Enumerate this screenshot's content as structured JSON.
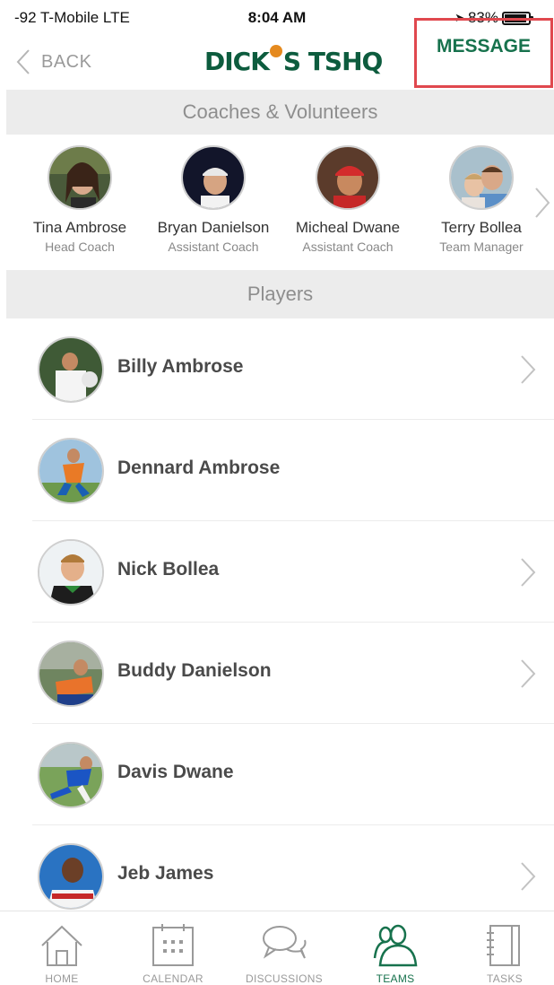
{
  "status_bar": {
    "carrier": "-92 T-Mobile  LTE",
    "time": "8:04 AM",
    "battery": "83%"
  },
  "nav": {
    "back_label": "BACK",
    "logo_text_left": "DICK",
    "logo_text_right": "S TSHQ",
    "message_label": "MESSAGE",
    "accent_color": "#17724d",
    "highlight_color": "#e0484e"
  },
  "coaches_section": {
    "title": "Coaches & Volunteers",
    "items": [
      {
        "name": "Tina Ambrose",
        "role": "Head Coach"
      },
      {
        "name": "Bryan Danielson",
        "role": "Assistant Coach"
      },
      {
        "name": "Micheal Dwane",
        "role": "Assistant Coach"
      },
      {
        "name": "Terry Bollea",
        "role": "Team Manager"
      }
    ]
  },
  "players_section": {
    "title": "Players",
    "items": [
      {
        "name": "Billy Ambrose",
        "has_chevron": true
      },
      {
        "name": "Dennard Ambrose",
        "has_chevron": false
      },
      {
        "name": "Nick Bollea",
        "has_chevron": true
      },
      {
        "name": "Buddy Danielson",
        "has_chevron": true
      },
      {
        "name": "Davis Dwane",
        "has_chevron": false
      },
      {
        "name": "Jeb James",
        "has_chevron": true
      }
    ]
  },
  "tab_bar": {
    "tabs": [
      {
        "label": "HOME",
        "icon": "home-icon",
        "active": false
      },
      {
        "label": "CALENDAR",
        "icon": "calendar-icon",
        "active": false
      },
      {
        "label": "DISCUSSIONS",
        "icon": "discussions-icon",
        "active": false
      },
      {
        "label": "TEAMS",
        "icon": "teams-icon",
        "active": true
      },
      {
        "label": "TASKS",
        "icon": "tasks-icon",
        "active": false
      }
    ]
  }
}
